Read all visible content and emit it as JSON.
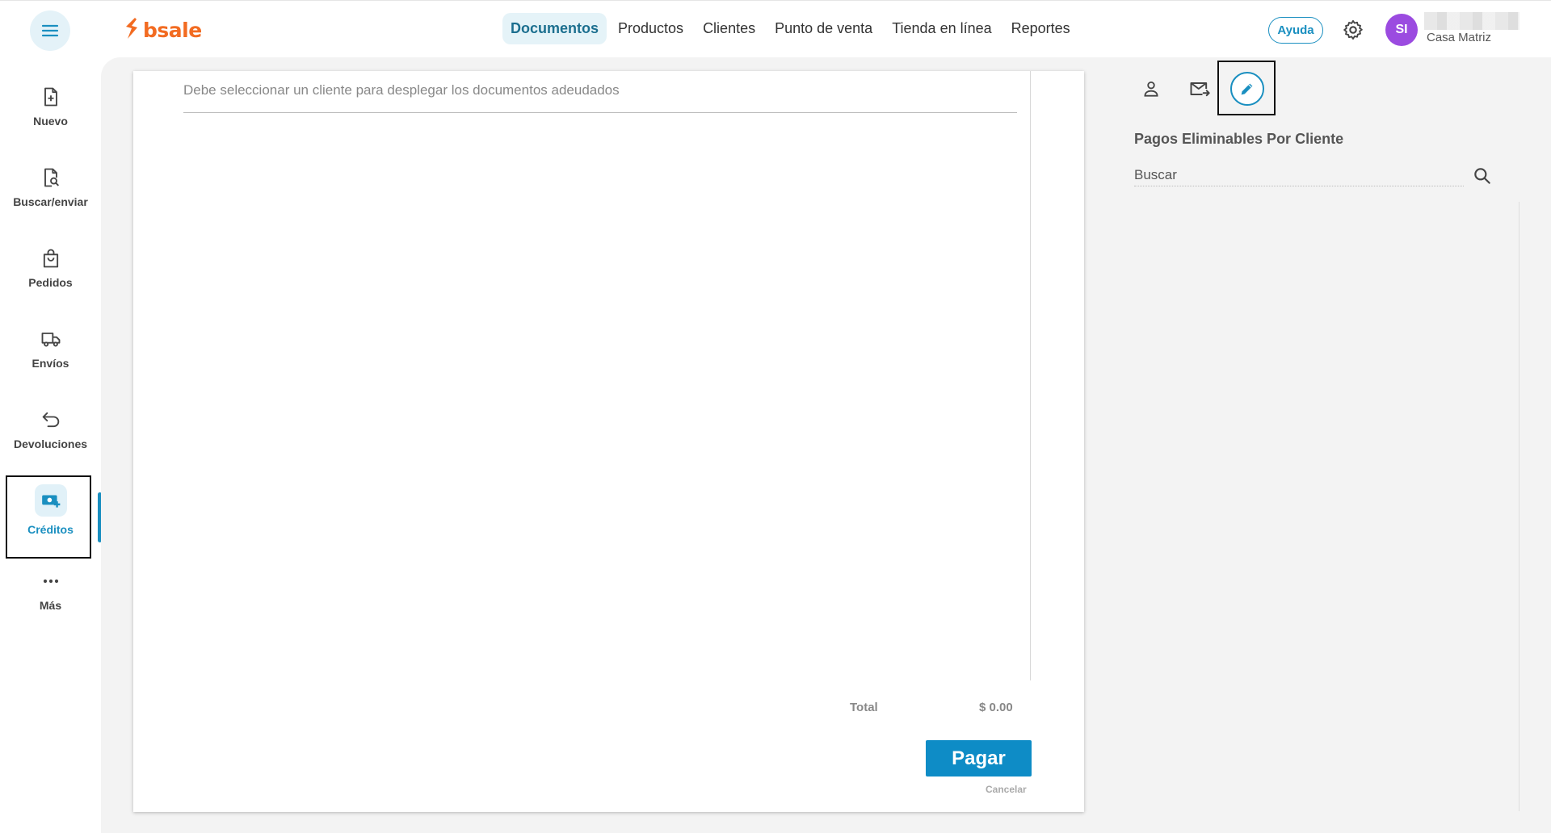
{
  "app": {
    "brand": "bsale"
  },
  "topnav": {
    "items": [
      {
        "label": "Documentos",
        "active": true
      },
      {
        "label": "Productos",
        "active": false
      },
      {
        "label": "Clientes",
        "active": false
      },
      {
        "label": "Punto de venta",
        "active": false
      },
      {
        "label": "Tienda en línea",
        "active": false
      },
      {
        "label": "Reportes",
        "active": false
      }
    ],
    "help_label": "Ayuda",
    "avatar_initials": "SI",
    "branch": "Casa Matriz"
  },
  "sidebar": {
    "items": [
      {
        "label": "Nuevo",
        "icon": "file-plus-icon"
      },
      {
        "label": "Buscar/enviar",
        "icon": "file-search-icon"
      },
      {
        "label": "Pedidos",
        "icon": "bag-icon"
      },
      {
        "label": "Envíos",
        "icon": "truck-icon"
      },
      {
        "label": "Devoluciones",
        "icon": "undo-arrow-icon"
      },
      {
        "label": "Créditos",
        "icon": "money-plus-icon",
        "active": true
      },
      {
        "label": "Más",
        "icon": "more-dots-icon"
      }
    ]
  },
  "card": {
    "message": "Debe seleccionar un cliente para desplegar los documentos adeudados",
    "total_label": "Total",
    "total_value": "$ 0.00",
    "pay_label": "Pagar",
    "cancel_label": "Cancelar"
  },
  "right_panel": {
    "title": "Pagos Eliminables Por Cliente",
    "search_placeholder": "Buscar"
  },
  "colors": {
    "accent": "#1a8fc0",
    "brand": "#f26b21",
    "pay_button": "#0e8cc6",
    "avatar": "#9b4be0"
  }
}
